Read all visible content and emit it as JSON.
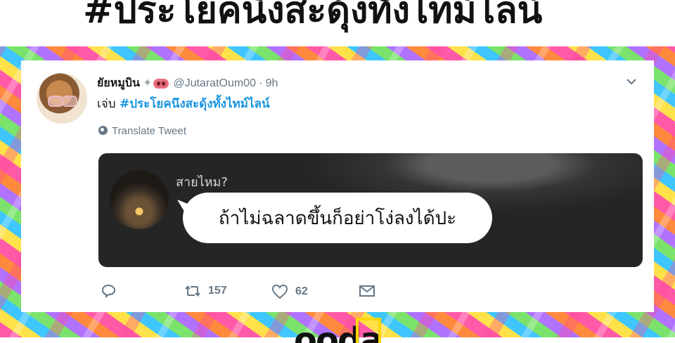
{
  "headline": "#ประโยคนึงสะดุ้งทั้งไทม์ไลน์",
  "tweet": {
    "display_name": "ยัยหมูบิน",
    "handle": "@JutaratOum00",
    "separator": "·",
    "time": "9h",
    "text_prefix": "เจ่บ",
    "hashtag": "#ประโยคนึงสะดุ้งทั้งไทม์ไลน์",
    "translate_label": "Translate Tweet",
    "badges": [
      "sparkle-icon",
      "pig-nose-icon"
    ]
  },
  "media": {
    "asker_label": "สายไหม?",
    "bubble_text": "ถ้าไม่ฉลาดขึ้นก็อย่าโง่ลงได้ปะ"
  },
  "actions": {
    "reply_count": "",
    "retweet_count": "157",
    "like_count": "62"
  },
  "brand": {
    "logo_text": "ooda"
  },
  "colors": {
    "link": "#1b95e0",
    "muted": "#657786",
    "text": "#14171a"
  }
}
